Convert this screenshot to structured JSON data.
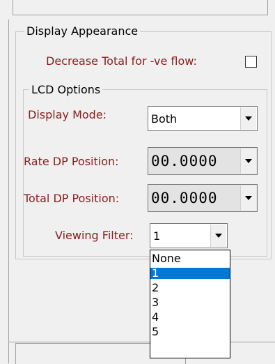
{
  "display_appearance": {
    "legend": "Display Appearance",
    "decrease_total_label": "Decrease Total for -ve flow:",
    "decrease_total_checked": false
  },
  "lcd_options": {
    "legend": "LCD Options",
    "display_mode": {
      "label": "Display Mode:",
      "value": "Both"
    },
    "rate_dp": {
      "label": "Rate DP Position:",
      "value": "00.0000"
    },
    "total_dp": {
      "label": "Total DP Position:",
      "value": "00.0000"
    },
    "viewing_filter": {
      "label": "Viewing Filter:",
      "value": "1",
      "options": [
        "None",
        "1",
        "2",
        "3",
        "4",
        "5"
      ],
      "selected_index": 1
    }
  },
  "colors": {
    "label_red": "#8b1c1c",
    "selection_blue": "#0078d7",
    "background": "#f0f0f0"
  }
}
